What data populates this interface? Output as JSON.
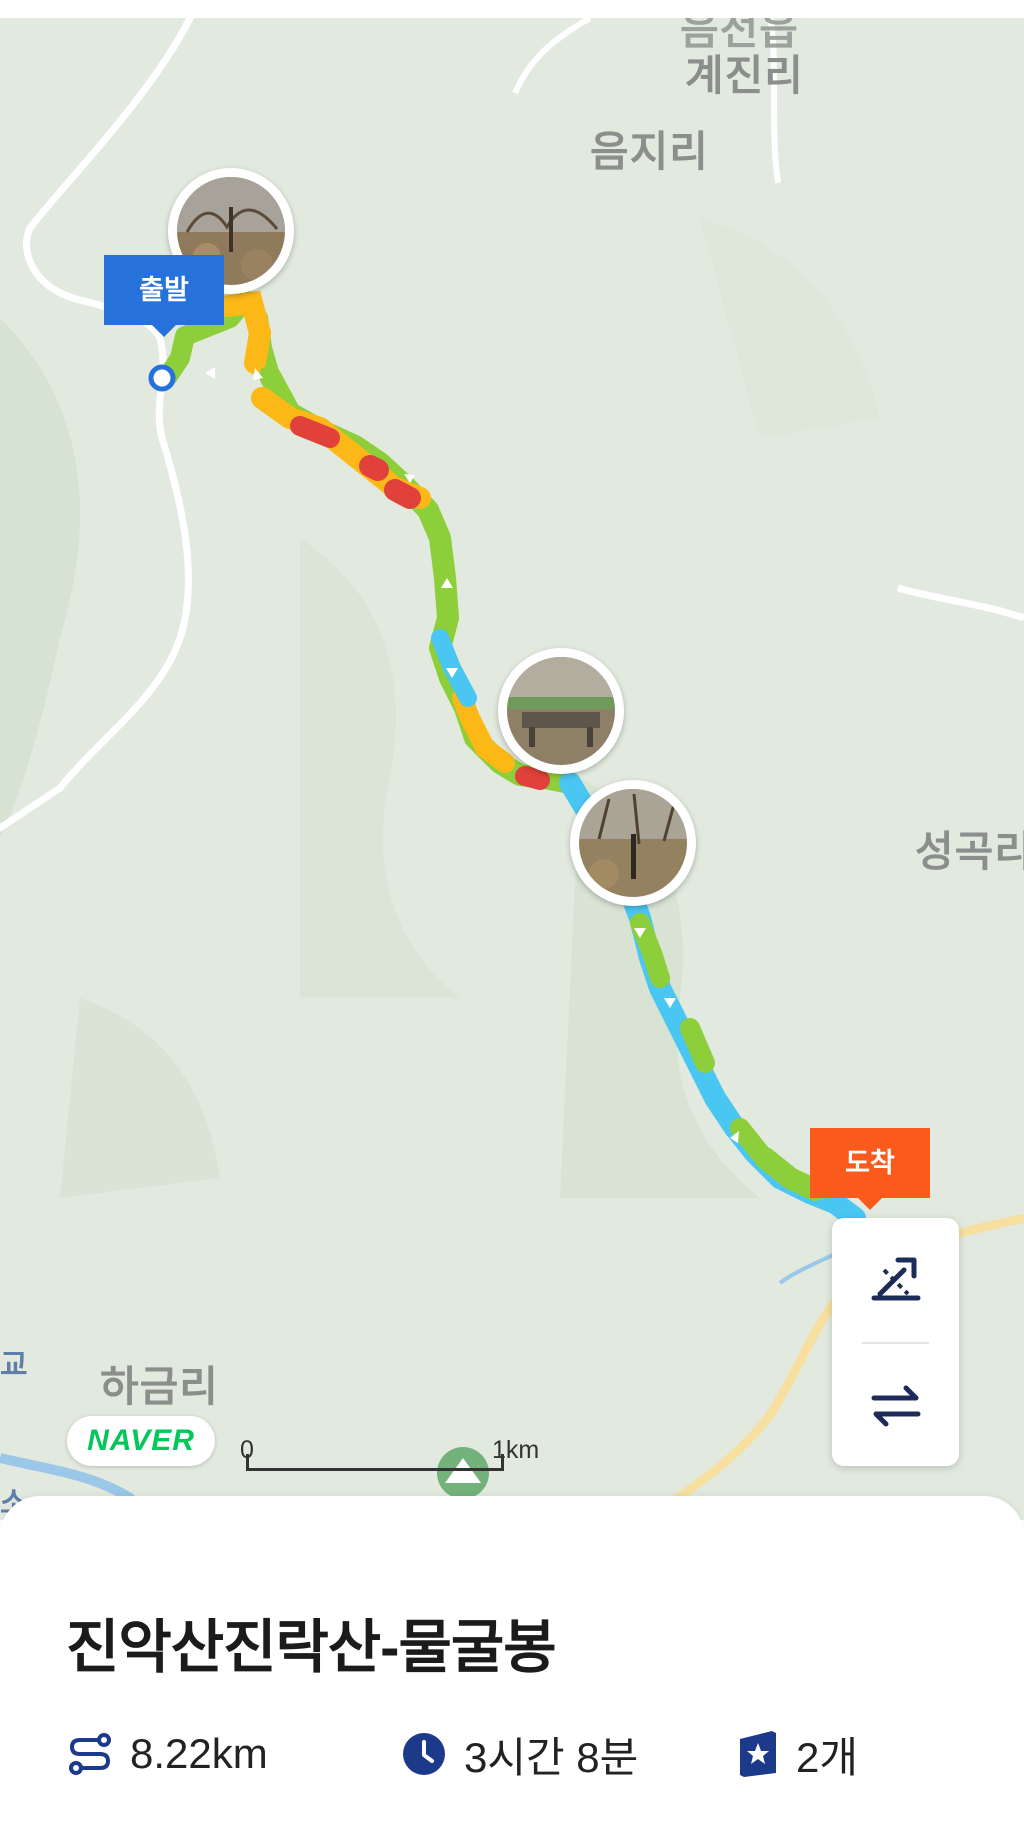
{
  "map": {
    "places": [
      {
        "id": "gyejin",
        "name": "계진리"
      },
      {
        "id": "eumji",
        "name": "음지리"
      },
      {
        "id": "seonggok",
        "name": "성곡리"
      },
      {
        "id": "hageum",
        "name": "하금리"
      },
      {
        "id": "partial-top",
        "name": "음전읍"
      },
      {
        "id": "partial-left1",
        "name": "교"
      },
      {
        "id": "partial-left2",
        "name": "소"
      }
    ],
    "start_label": "출발",
    "end_label": "도착",
    "provider_logo": "NAVER",
    "scale": {
      "start": "0",
      "end": "1km"
    },
    "photo_markers": 3,
    "route_colors": {
      "green": "#8dcf3a",
      "yellow": "#fbb817",
      "red": "#e0413a",
      "blue": "#4ac6f2"
    },
    "controls": [
      {
        "icon": "elevation-toggle-icon"
      },
      {
        "icon": "swap-direction-icon"
      }
    ]
  },
  "trail": {
    "title": "진악산진락산-물굴봉",
    "distance": "8.22km",
    "duration": "3시간 8분",
    "badges": "2개"
  },
  "icons": {
    "distance": "route-icon",
    "duration": "clock-icon",
    "badges": "badge-star-icon"
  }
}
